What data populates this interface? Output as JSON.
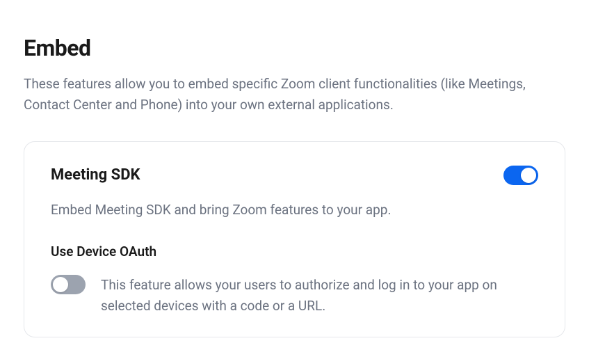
{
  "page": {
    "title": "Embed",
    "description": "These features allow you to embed specific Zoom client functionalities (like Meetings, Contact Center and Phone) into your own external applications."
  },
  "meeting_sdk": {
    "title": "Meeting SDK",
    "description": "Embed Meeting SDK and bring Zoom features to your app.",
    "enabled": true,
    "device_oauth": {
      "title": "Use Device OAuth",
      "description": "This feature allows your users to authorize and log in to your app on selected devices with a code or a URL.",
      "enabled": false
    }
  }
}
